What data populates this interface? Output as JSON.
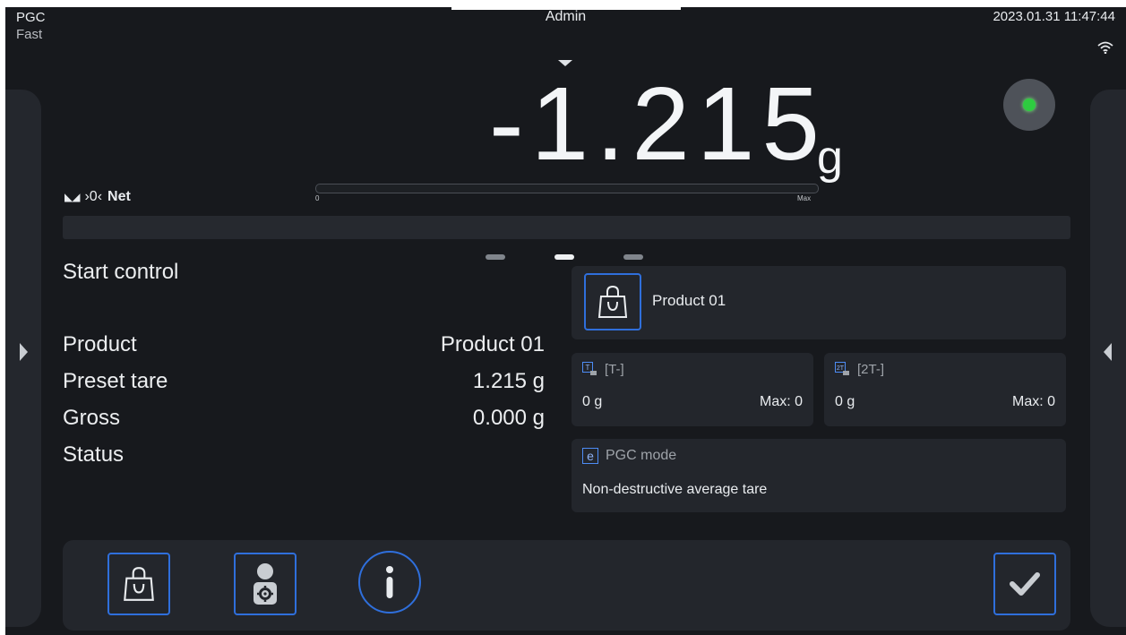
{
  "topbar": {
    "app_name": "PGC",
    "mode": "Fast",
    "user": "Admin",
    "datetime": "2023.01.31 11:47:44"
  },
  "display": {
    "value": "-1.215",
    "unit": "g",
    "indicators": {
      "zero_symbol": "›0‹",
      "net_label": "Net"
    },
    "bargraph": {
      "min_label": "0",
      "max_label": "Max",
      "fill_fraction": 0
    },
    "stability_light_color": "#2ecc40"
  },
  "main": {
    "page_count": 3,
    "active_page": 2,
    "start_label": "Start control",
    "rows": [
      {
        "label": "Product",
        "value": "Product 01"
      },
      {
        "label": "Preset tare",
        "value": "1.215 g"
      },
      {
        "label": "Gross",
        "value": "0.000 g"
      },
      {
        "label": "Status",
        "value": ""
      }
    ]
  },
  "cards": {
    "product": {
      "name": "Product 01"
    },
    "tare1": {
      "label": "[T-]",
      "value": "0 g",
      "max": "Max: 0",
      "icon_text": "T"
    },
    "tare2": {
      "label": "[2T-]",
      "value": "0 g",
      "max": "Max: 0",
      "icon_text": "2T"
    },
    "pgc": {
      "icon_text": "e",
      "label": "PGC mode",
      "value": "Non-destructive average tare"
    }
  },
  "colors": {
    "background": "#17191d",
    "panel": "#23262c",
    "accent_blue": "#2f6fdc",
    "stable_green": "#2ecc40"
  }
}
